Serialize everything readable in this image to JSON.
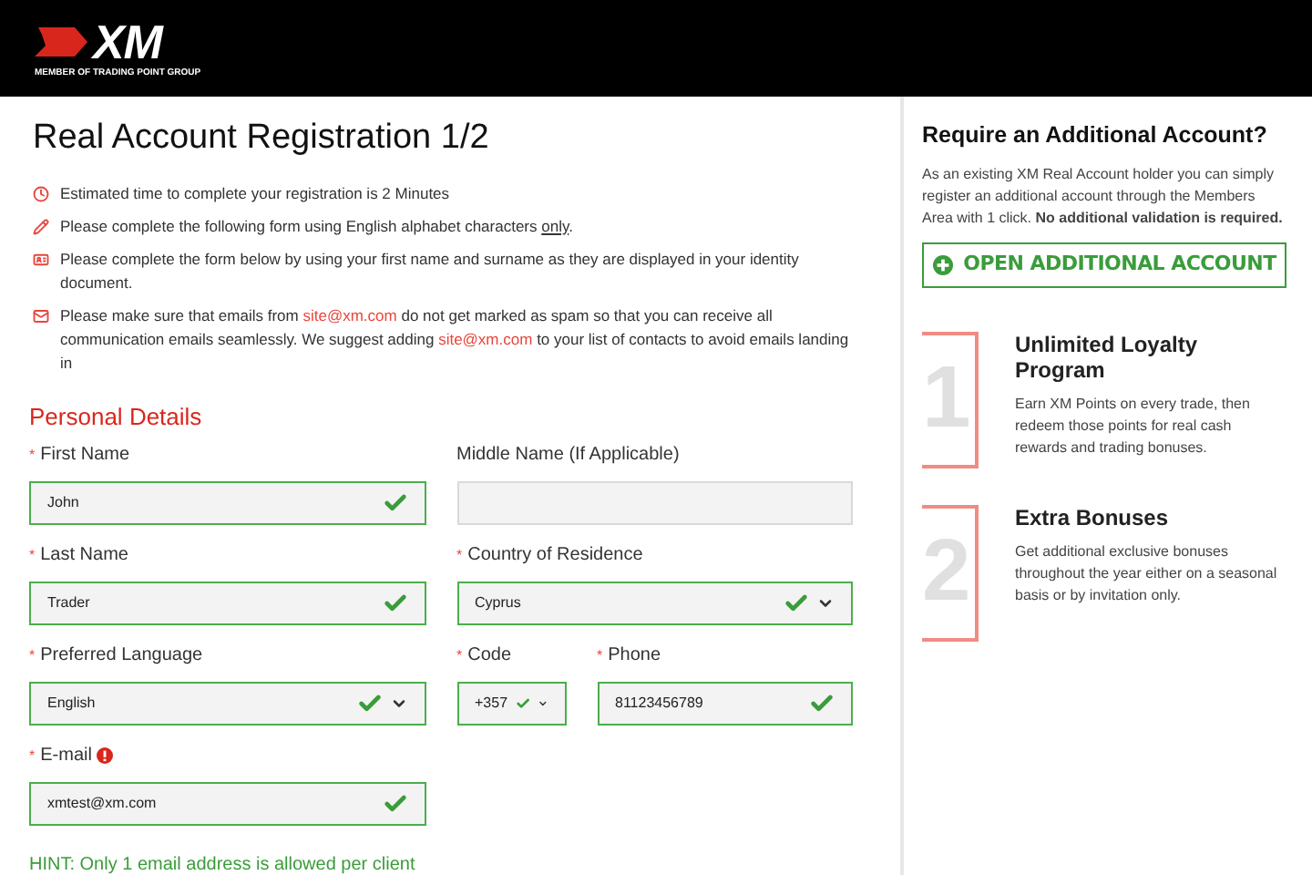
{
  "header": {
    "logo": "XM",
    "tagline": "MEMBER OF TRADING POINT GROUP"
  },
  "title": "Real Account Registration 1/2",
  "notices": [
    {
      "kind": "clock",
      "parts": [
        {
          "kind": "text",
          "text": "Estimated time to complete your registration is 2 Minutes"
        }
      ]
    },
    {
      "kind": "pencil",
      "parts": [
        {
          "kind": "text",
          "text": "Please complete the following form using English alphabet characters"
        },
        {
          "kind": "underline",
          "text": "only"
        },
        {
          "kind": "text",
          "text": "."
        }
      ]
    },
    {
      "kind": "id-card",
      "parts": [
        {
          "kind": "text",
          "text": "Please complete the form below by using your first name and surname as they are displayed in your identity document."
        }
      ]
    },
    {
      "kind": "mail",
      "parts": [
        {
          "kind": "text",
          "text": "Please make sure that emails from"
        },
        {
          "kind": "link",
          "text": "site@xm.com"
        },
        {
          "kind": "text",
          "text": "do not get marked as spam so that you can receive all communication emails seamlessly. We suggest adding"
        },
        {
          "kind": "link",
          "text": "site@xm.com"
        },
        {
          "kind": "text",
          "text": "to your list of contacts to avoid emails landing in"
        }
      ]
    }
  ],
  "section": {
    "title_accent": "Personal",
    "title_rest": "Details"
  },
  "rows": [
    [
      {
        "kind": "text",
        "required_mark": "*",
        "label": "First Name",
        "value": "John",
        "valid": true,
        "info": false
      }
    ],
    [
      {
        "kind": "text",
        "label": "Middle Name (If Applicable)",
        "valid": false,
        "info": false
      }
    ],
    [
      {
        "kind": "text",
        "required_mark": "*",
        "label": "Last Name",
        "value": "Trader",
        "valid": true,
        "info": false
      }
    ],
    [
      {
        "kind": "select",
        "required_mark": "*",
        "label": "Country of Residence",
        "value": "Cyprus",
        "valid": true,
        "info": false
      }
    ],
    [
      {
        "kind": "select",
        "required_mark": "*",
        "label": "Preferred Language",
        "value": "English",
        "valid": true,
        "info": false
      }
    ],
    [
      {
        "kind": "select",
        "required_mark": "*",
        "label": "Code",
        "value": "+357",
        "valid": true,
        "info": false
      },
      {
        "kind": "text",
        "required_mark": "*",
        "label": "Phone",
        "value": "81123456789",
        "valid": true,
        "info": false
      }
    ],
    [
      {
        "kind": "text",
        "required_mark": "*",
        "label": "E-mail",
        "value": "xmtest@xm.com",
        "valid": true,
        "info": true
      }
    ]
  ],
  "hint": "HINT: Only 1 email address is allowed per client",
  "sidebar": {
    "title": "Require an Additional Account?",
    "text": "As an existing XM Real Account holder you can simply register an additional account through the Members Area with 1 click. **No additional validation is required.**",
    "button": "OPEN ADDITIONAL ACCOUNT",
    "features": [
      {
        "number": "1",
        "title": "Unlimited Loyalty Program",
        "text": "Earn XM Points on every trade, then redeem those points for real cash rewards and trading bonuses."
      },
      {
        "number": "2",
        "title": "Extra Bonuses",
        "text": "Get additional exclusive bonuses throughout the year either on a seasonal basis or by invitation only."
      }
    ]
  }
}
